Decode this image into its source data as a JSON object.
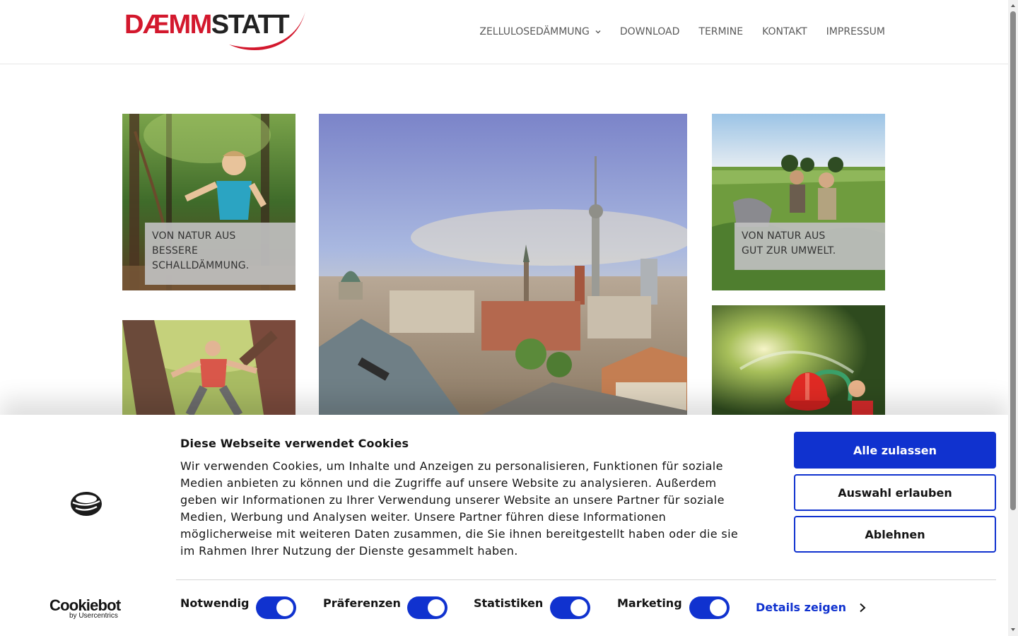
{
  "brand": {
    "logo_part_red": "DÆMM",
    "logo_part_dark": "STATT",
    "accent_red": "#d3182d",
    "accent_blue": "#1032cf"
  },
  "nav": {
    "items": [
      {
        "label": "ZELLULOSEDÄMMUNG",
        "has_dropdown": true,
        "icon": "chevron-down-icon"
      },
      {
        "label": "DOWNLOAD"
      },
      {
        "label": "TERMINE"
      },
      {
        "label": "KONTAKT"
      },
      {
        "label": "IMPRESSUM"
      }
    ]
  },
  "grid": {
    "tiles": [
      {
        "name": "boy-forest-photo",
        "caption_lines": [
          "VON NATUR AUS",
          "BESSERE",
          "SCHALLDÄMMUNG."
        ]
      },
      {
        "name": "berlin-skyline-photo"
      },
      {
        "name": "field-people-photo",
        "caption_lines": [
          "VON NATUR AUS",
          "GUT ZUR UMWELT."
        ]
      },
      {
        "name": "man-tree-photo"
      },
      {
        "name": "fire-hose-child-photo"
      }
    ]
  },
  "cookie": {
    "title": "Diese Webseite verwendet Cookies",
    "text": "Wir verwenden Cookies, um Inhalte und Anzeigen zu personalisieren, Funktionen für soziale Medien anbieten zu können und die Zugriffe auf unsere Website zu analysieren. Außerdem geben wir Informationen zu Ihrer Verwendung unserer Website an unsere Partner für soziale Medien, Werbung und Analysen weiter. Unsere Partner führen diese Informationen möglicherweise mit weiteren Daten zusammen, die Sie ihnen bereitgestellt haben oder die sie im Rahmen Ihrer Nutzung der Dienste gesammelt haben.",
    "buttons": {
      "allow_all": "Alle zulassen",
      "allow_selection": "Auswahl erlauben",
      "deny": "Ablehnen"
    },
    "toggles": [
      {
        "label": "Notwendig",
        "on": true
      },
      {
        "label": "Präferenzen",
        "on": true
      },
      {
        "label": "Statistiken",
        "on": true
      },
      {
        "label": "Marketing",
        "on": true
      }
    ],
    "details_label": "Details zeigen",
    "provider_main": "Cookiebot",
    "provider_sub": "by Usercentrics"
  }
}
